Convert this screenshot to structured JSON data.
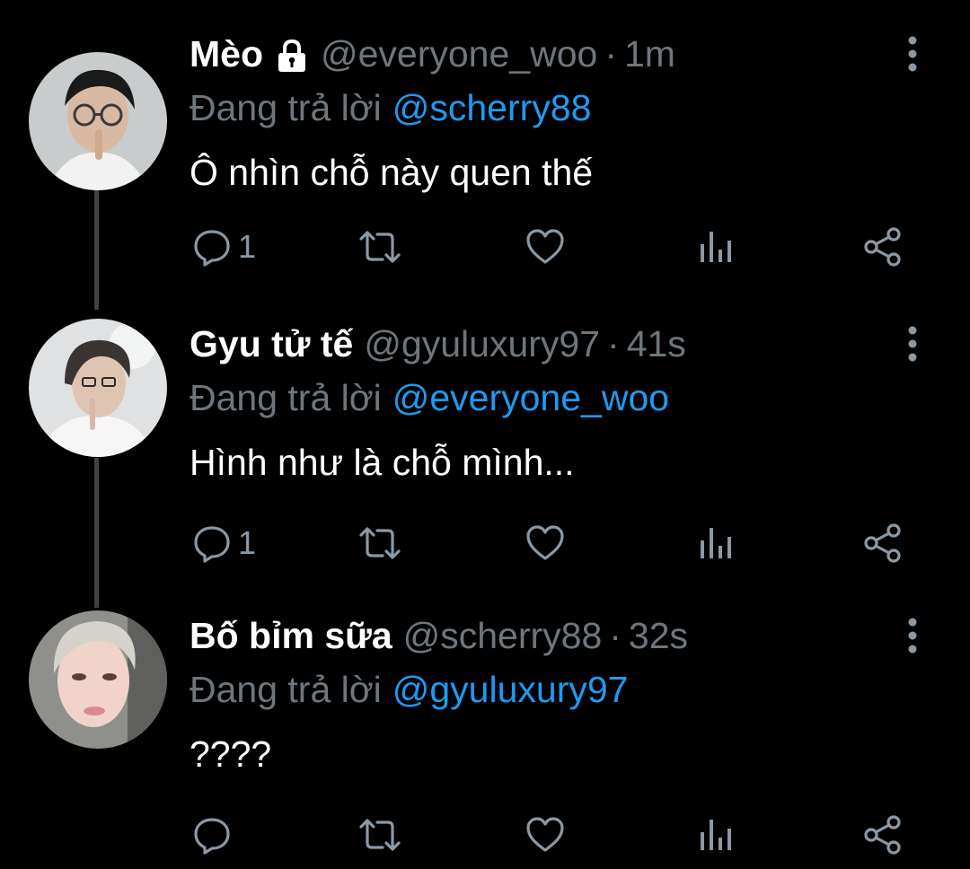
{
  "tweets": [
    {
      "display_name": "Mèo",
      "handle": "@everyone_woo",
      "separator": "·",
      "time": "1m",
      "reply_prefix": "Đang trả lời",
      "reply_to": "@scherry88",
      "text": "Ô nhìn chỗ này quen thế",
      "reply_count": "1",
      "locked": true
    },
    {
      "display_name": "Gyu tử tế",
      "handle": "@gyuluxury97",
      "separator": "·",
      "time": "41s",
      "reply_prefix": "Đang trả lời",
      "reply_to": "@everyone_woo",
      "text": "Hình như là chỗ mình...",
      "reply_count": "1",
      "locked": false
    },
    {
      "display_name": "Bố bỉm sữa",
      "handle": "@scherry88",
      "separator": "·",
      "time": "32s",
      "reply_prefix": "Đang trả lời",
      "reply_to": "@gyuluxury97",
      "text": "????",
      "reply_count": "",
      "locked": false
    }
  ],
  "icons": [
    "lock-icon",
    "more-vertical-icon",
    "reply-icon",
    "retweet-icon",
    "like-icon",
    "analytics-icon",
    "share-icon"
  ],
  "colors": {
    "background": "#000000",
    "text": "#ffffff",
    "muted": "#6e767d",
    "link": "#1d9bf0",
    "thread_line": "#3b4248"
  }
}
